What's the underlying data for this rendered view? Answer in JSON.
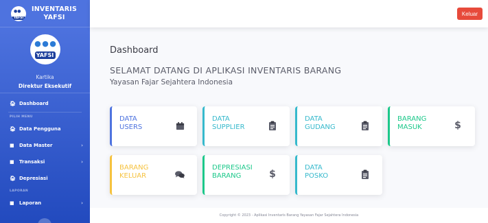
{
  "brand": {
    "line1": "INVENTARIS",
    "line2": "YAFSI",
    "logo_text": "YAFSI"
  },
  "profile": {
    "logo_text": "YAFSI",
    "name": "Kartika",
    "role": "Direktur Eksekutif"
  },
  "sidebar": {
    "dashboard": "Dashboard",
    "heading_main": "PILIH MENU",
    "data_pengguna": "Data Pengguna",
    "data_master": "Data Master",
    "transaksi": "Transaksi",
    "depresiasi": "Depresiasi",
    "heading_report": "LAPORAN",
    "laporan": "Laporan"
  },
  "topbar": {
    "logout_label": "Keluar"
  },
  "main": {
    "title": "Dashboard",
    "welcome": "SELAMAT DATANG DI APLIKASI INVENTARIS BARANG",
    "org": "Yayasan Fajar Sejahtera Indonesia"
  },
  "cards": [
    {
      "label": "DATA\nUSERS",
      "color": "#4e73df",
      "icon": "calendar-icon"
    },
    {
      "label": "DATA\nSUPPLIER",
      "color": "#36b9cc",
      "icon": "clipboard-icon"
    },
    {
      "label": "DATA\nGUDANG",
      "color": "#36b9cc",
      "icon": "clipboard-icon"
    },
    {
      "label": "BARANG\nMASUK",
      "color": "#1cc88a",
      "icon": "dollar-icon"
    },
    {
      "label": "BARANG\nKELUAR",
      "color": "#f6c23e",
      "icon": "comments-icon"
    },
    {
      "label": "DEPRESIASI\nBARANG",
      "color": "#1cc88a",
      "icon": "dollar-icon"
    },
    {
      "label": "DATA\nPOSKO",
      "color": "#36b9cc",
      "icon": "clipboard-icon"
    }
  ],
  "footer": {
    "text": "Copyright © 2023 - Aplikasi Inventaris Barang Yayasan Fajar Sejahtera Indonesia"
  },
  "colors": {
    "primary": "#4e73df",
    "danger": "#e74a3b",
    "text_dark": "#3a3b45"
  }
}
